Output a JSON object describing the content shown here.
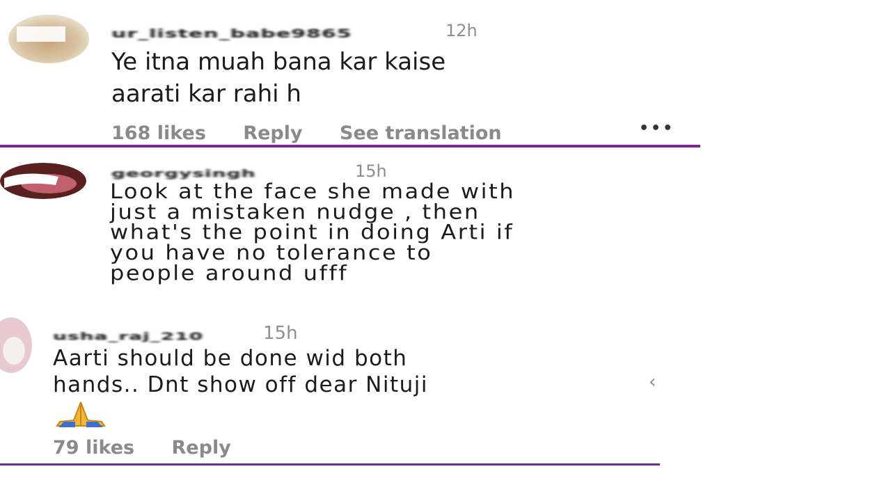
{
  "comments": [
    {
      "username": "ur_listen_babe9865",
      "time": "12h",
      "lines": [
        "Ye itna muah bana kar kaise",
        "aarati kar rahi h"
      ],
      "likes": "168 likes",
      "reply": "Reply",
      "translate": "See translation",
      "more": "•••"
    },
    {
      "username": "georgysingh",
      "time": "15h",
      "lines": [
        "Look at the face she made with",
        "just a mistaken nudge , then",
        "what's the point in doing Arti if",
        "you have no tolerance to",
        "people around ufff"
      ]
    },
    {
      "username": "usha_raj_210",
      "time": "15h",
      "lines": [
        "Aarti should be done wid both",
        "hands.. Dnt show off dear Nituji"
      ],
      "emoji": "🙏",
      "likes": "79 likes",
      "reply": "Reply"
    }
  ],
  "colors": {
    "divider": "#7a2a8c",
    "meta_text": "#8a8a8a",
    "body_text": "#1b1b1b",
    "background": "#ffffff"
  },
  "icons": [
    "praying-hands-emoji",
    "more-options-icon"
  ]
}
